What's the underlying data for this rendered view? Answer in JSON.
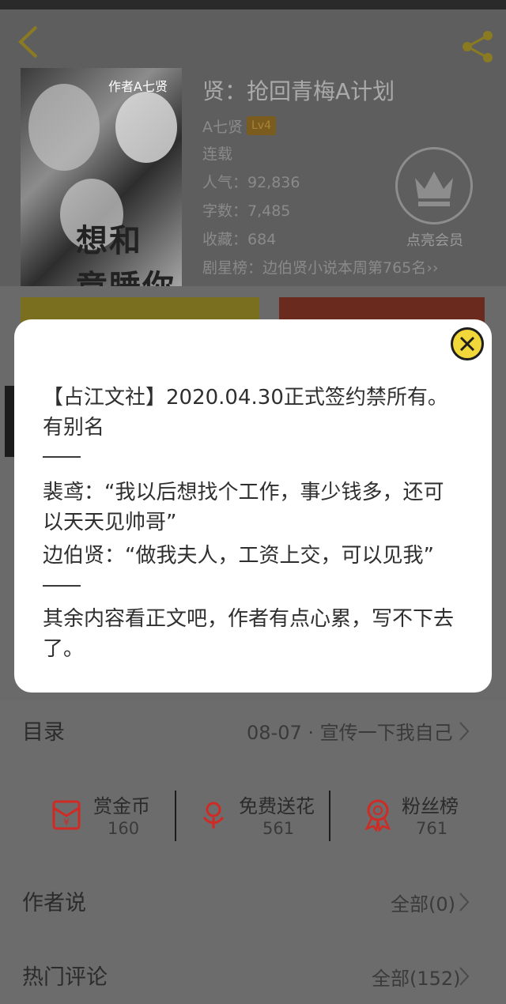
{
  "book": {
    "cover_title": "作者A七贤",
    "cover_subtitle": "想和",
    "cover_bottom": "竟睡你",
    "title": "贤：抢回青梅A计划",
    "author": "A七贤",
    "level": "Lv4",
    "status": "连载",
    "popularity": "人气：92,836",
    "word_count": "字数：7,485",
    "favorites": "收藏：684",
    "ranking": "剧星榜：边伯贤小说本周第765名››",
    "vip_label": "点亮会员"
  },
  "modal": {
    "line1": "【占江文社】2020.04.30正式签约禁所有。有别名",
    "line2": "裴鸢：“我以后想找个工作，事少钱多，还可以天天见帅哥”",
    "line3": "边伯贤：“做我夫人，工资上交，可以见我”",
    "line4": "其余内容看正文吧，作者有点心累，写不下去了。"
  },
  "toc": {
    "label": "目录",
    "latest": "08-07 · 宣传一下我自己"
  },
  "stats": [
    {
      "name": "赏金币",
      "value": "160",
      "icon": "red-envelope-icon"
    },
    {
      "name": "免费送花",
      "value": "561",
      "icon": "flower-icon"
    },
    {
      "name": "粉丝榜",
      "value": "761",
      "icon": "badge-icon"
    }
  ],
  "author_says": {
    "label": "作者说",
    "right": "全部(0)"
  },
  "hot_comments": {
    "label": "热门评论",
    "right": "全部(152)"
  },
  "colors": {
    "accent_yellow": "#f2d73a",
    "icon_red": "#d02a25"
  }
}
